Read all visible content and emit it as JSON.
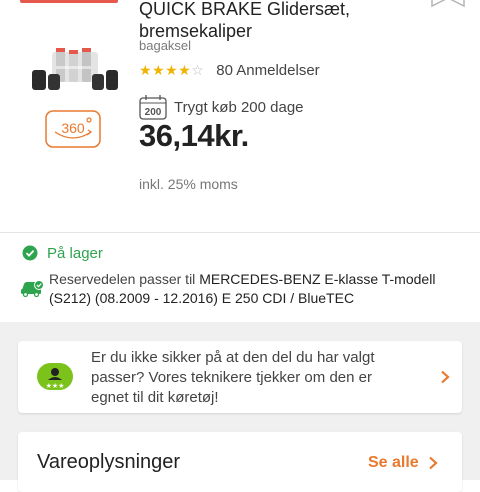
{
  "product": {
    "title_line1": "QUICK BRAKE Glidersæt,",
    "title_line2": "bremsekaliper",
    "subtitle": "bagaksel",
    "rating": {
      "stars_filled": 4,
      "stars_total": 5,
      "stars_display_filled": "★★★★",
      "stars_display_empty": "☆",
      "reviews_label": "80 Anmeldelser"
    },
    "view360_label": "360",
    "trust_badge_number": "200",
    "trust_text": "Trygt køb 200 dage",
    "price": "36,14kr.",
    "vat_note": "inkl. 25% moms"
  },
  "availability": {
    "stock_label": "På lager",
    "fit_prefix": "Reservedelen passer til ",
    "fit_vehicle": "MERCEDES-BENZ E-klasse T-modell (S212) (08.2009 - 12.2016) E 250 CDI / BlueTEC"
  },
  "help": {
    "text": "Er du ikke sikker på at den del du har valgt passer? Vores teknikere tjekker om den er egnet  til dit køretøj!"
  },
  "info": {
    "title": "Vareoplysninger",
    "see_all": "Se alle"
  },
  "colors": {
    "accent_orange": "#e8792f",
    "star_gold": "#f0b400",
    "stock_green": "#2ea44f",
    "top_accent_red": "#e6584c",
    "help_badge_green": "#7bc21a"
  },
  "icons": [
    "bookmark-icon",
    "view-360-icon",
    "calendar-icon",
    "check-circle-icon",
    "car-check-icon",
    "technician-badge-icon",
    "chevron-right-icon"
  ]
}
